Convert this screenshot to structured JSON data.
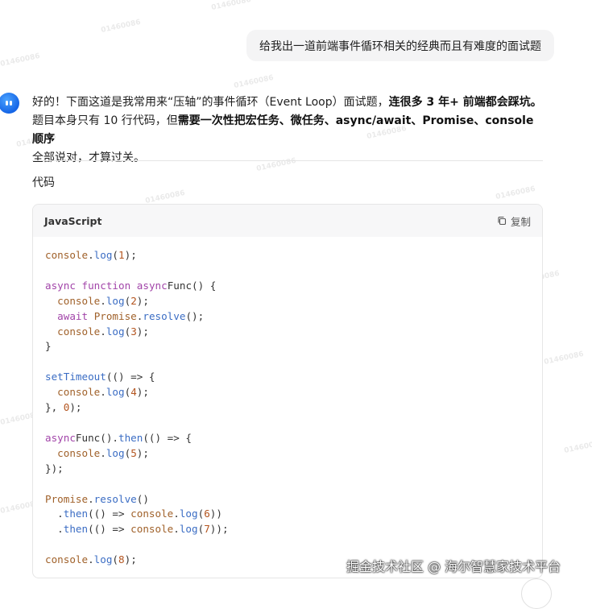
{
  "user_message": "给我出一道前端事件循环相关的经典而且有难度的面试题",
  "answer": {
    "line1_a": "好的！下面这道是我常用来“压轴”的事件循环（Event Loop）面试题，",
    "line1_b": "连很多 3 年+ 前端都会踩坑。",
    "line2_a": "题目本身只有 10 行代码，但",
    "line2_b": "需要一次性把宏任务、微任务、async/await、Promise、console 顺序",
    "line3": "全部说对，才算过关。"
  },
  "section_title": "代码",
  "code_block": {
    "language": "JavaScript",
    "copy_label": "复制",
    "copy_icon": "copy-icon",
    "code": "console.log(1);\n\nasync function asyncFunc() {\n  console.log(2);\n  await Promise.resolve();\n  console.log(3);\n}\n\nsetTimeout(() => {\n  console.log(4);\n}, 0);\n\nasyncFunc().then(() => {\n  console.log(5);\n});\n\nPromise.resolve()\n  .then(() => console.log(6))\n  .then(() => console.log(7));\n\nconsole.log(8);"
  },
  "watermark_text": "01460086",
  "footer_watermark": "掘金技术社区 @ 海尔智慧家技术平台",
  "colors": {
    "keyword": "#a245a9",
    "function": "#3b6dc4",
    "object": "#a0612a",
    "number": "#b3541e",
    "avatar": "#1565e6"
  }
}
